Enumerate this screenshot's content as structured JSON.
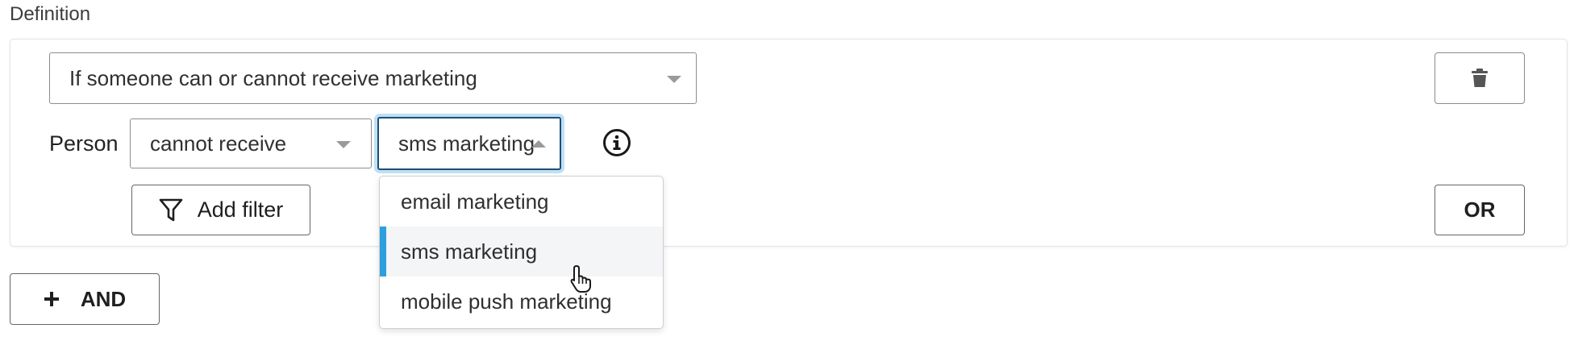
{
  "section": {
    "title": "Definition"
  },
  "condition": {
    "type_select": "If someone can or cannot receive marketing",
    "subject_label": "Person",
    "ability_select": "cannot receive",
    "channel_select": "sms marketing",
    "channel_options": [
      "email marketing",
      "sms marketing",
      "mobile push marketing"
    ],
    "highlighted_option_index": 1
  },
  "buttons": {
    "add_filter": "Add filter",
    "or": "OR",
    "and": "AND"
  },
  "icons": {
    "delete": "trash-icon",
    "info": "info-icon",
    "filter": "funnel-icon",
    "add": "plus-icon",
    "cursor": "hand-pointer-icon"
  },
  "colors": {
    "focus_border": "#1e4f78",
    "focus_glow": "#bfe0f4",
    "highlight_bar": "#2d9fdc"
  }
}
